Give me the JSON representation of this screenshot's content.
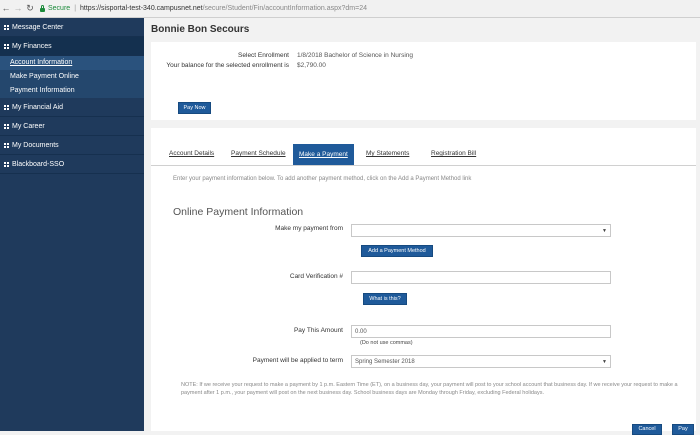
{
  "browser": {
    "back_icon": "arrow-left",
    "forward_icon": "arrow-right",
    "reload_icon": "reload",
    "secure_label": "Secure",
    "url_host": "https://sisportal-test-340.campusnet.net",
    "url_path": "/secure/Student/Fin/accountInformation.aspx?dm=24"
  },
  "sidebar": {
    "items": [
      {
        "label": "Message Center"
      },
      {
        "label": "My Finances"
      },
      {
        "label": "My Financial Aid"
      },
      {
        "label": "My Career"
      },
      {
        "label": "My Documents"
      },
      {
        "label": "Blackboard-SSO"
      }
    ],
    "finances_sub": [
      {
        "label": "Account Information"
      },
      {
        "label": "Make Payment Online"
      },
      {
        "label": "Payment Information"
      }
    ]
  },
  "student": {
    "name": "Bonnie Bon Secours"
  },
  "enrollment": {
    "select_label": "Select Enrollment",
    "select_value": "1/8/2018 Bachelor of Science in Nursing",
    "balance_label": "Your balance for the selected enrollment is",
    "balance_value": "$2,790.00",
    "pay_now_label": "Pay Now"
  },
  "tabs": [
    "Account Details",
    "Payment Schedule",
    "Make a Payment",
    "My Statements",
    "Registration Bill"
  ],
  "payment": {
    "instructions": "Enter your payment information below. To add another payment method, click on the Add a Payment Method link",
    "section_title": "Online Payment Information",
    "make_from_label": "Make my payment from",
    "make_from_value": "",
    "add_method_label": "Add a Payment Method",
    "cvv_label": "Card Verification #",
    "cvv_value": "",
    "whats_this_label": "What is this?",
    "amount_label": "Pay This Amount",
    "amount_value": "0.00",
    "amount_hint": "(Do not use commas)",
    "term_label": "Payment will be applied to term",
    "term_value": "Spring Semester 2018",
    "note": "NOTE: If we receive your request to make a payment by 1 p.m. Eastern Time (ET), on a business day, your payment will post to your school account that business day. If we receive your request to make a payment after 1 p.m., your payment will post on the next business day. School business days are Monday through Friday, excluding Federal holidays.",
    "cancel_label": "Cancel",
    "pay_label": "Pay"
  }
}
